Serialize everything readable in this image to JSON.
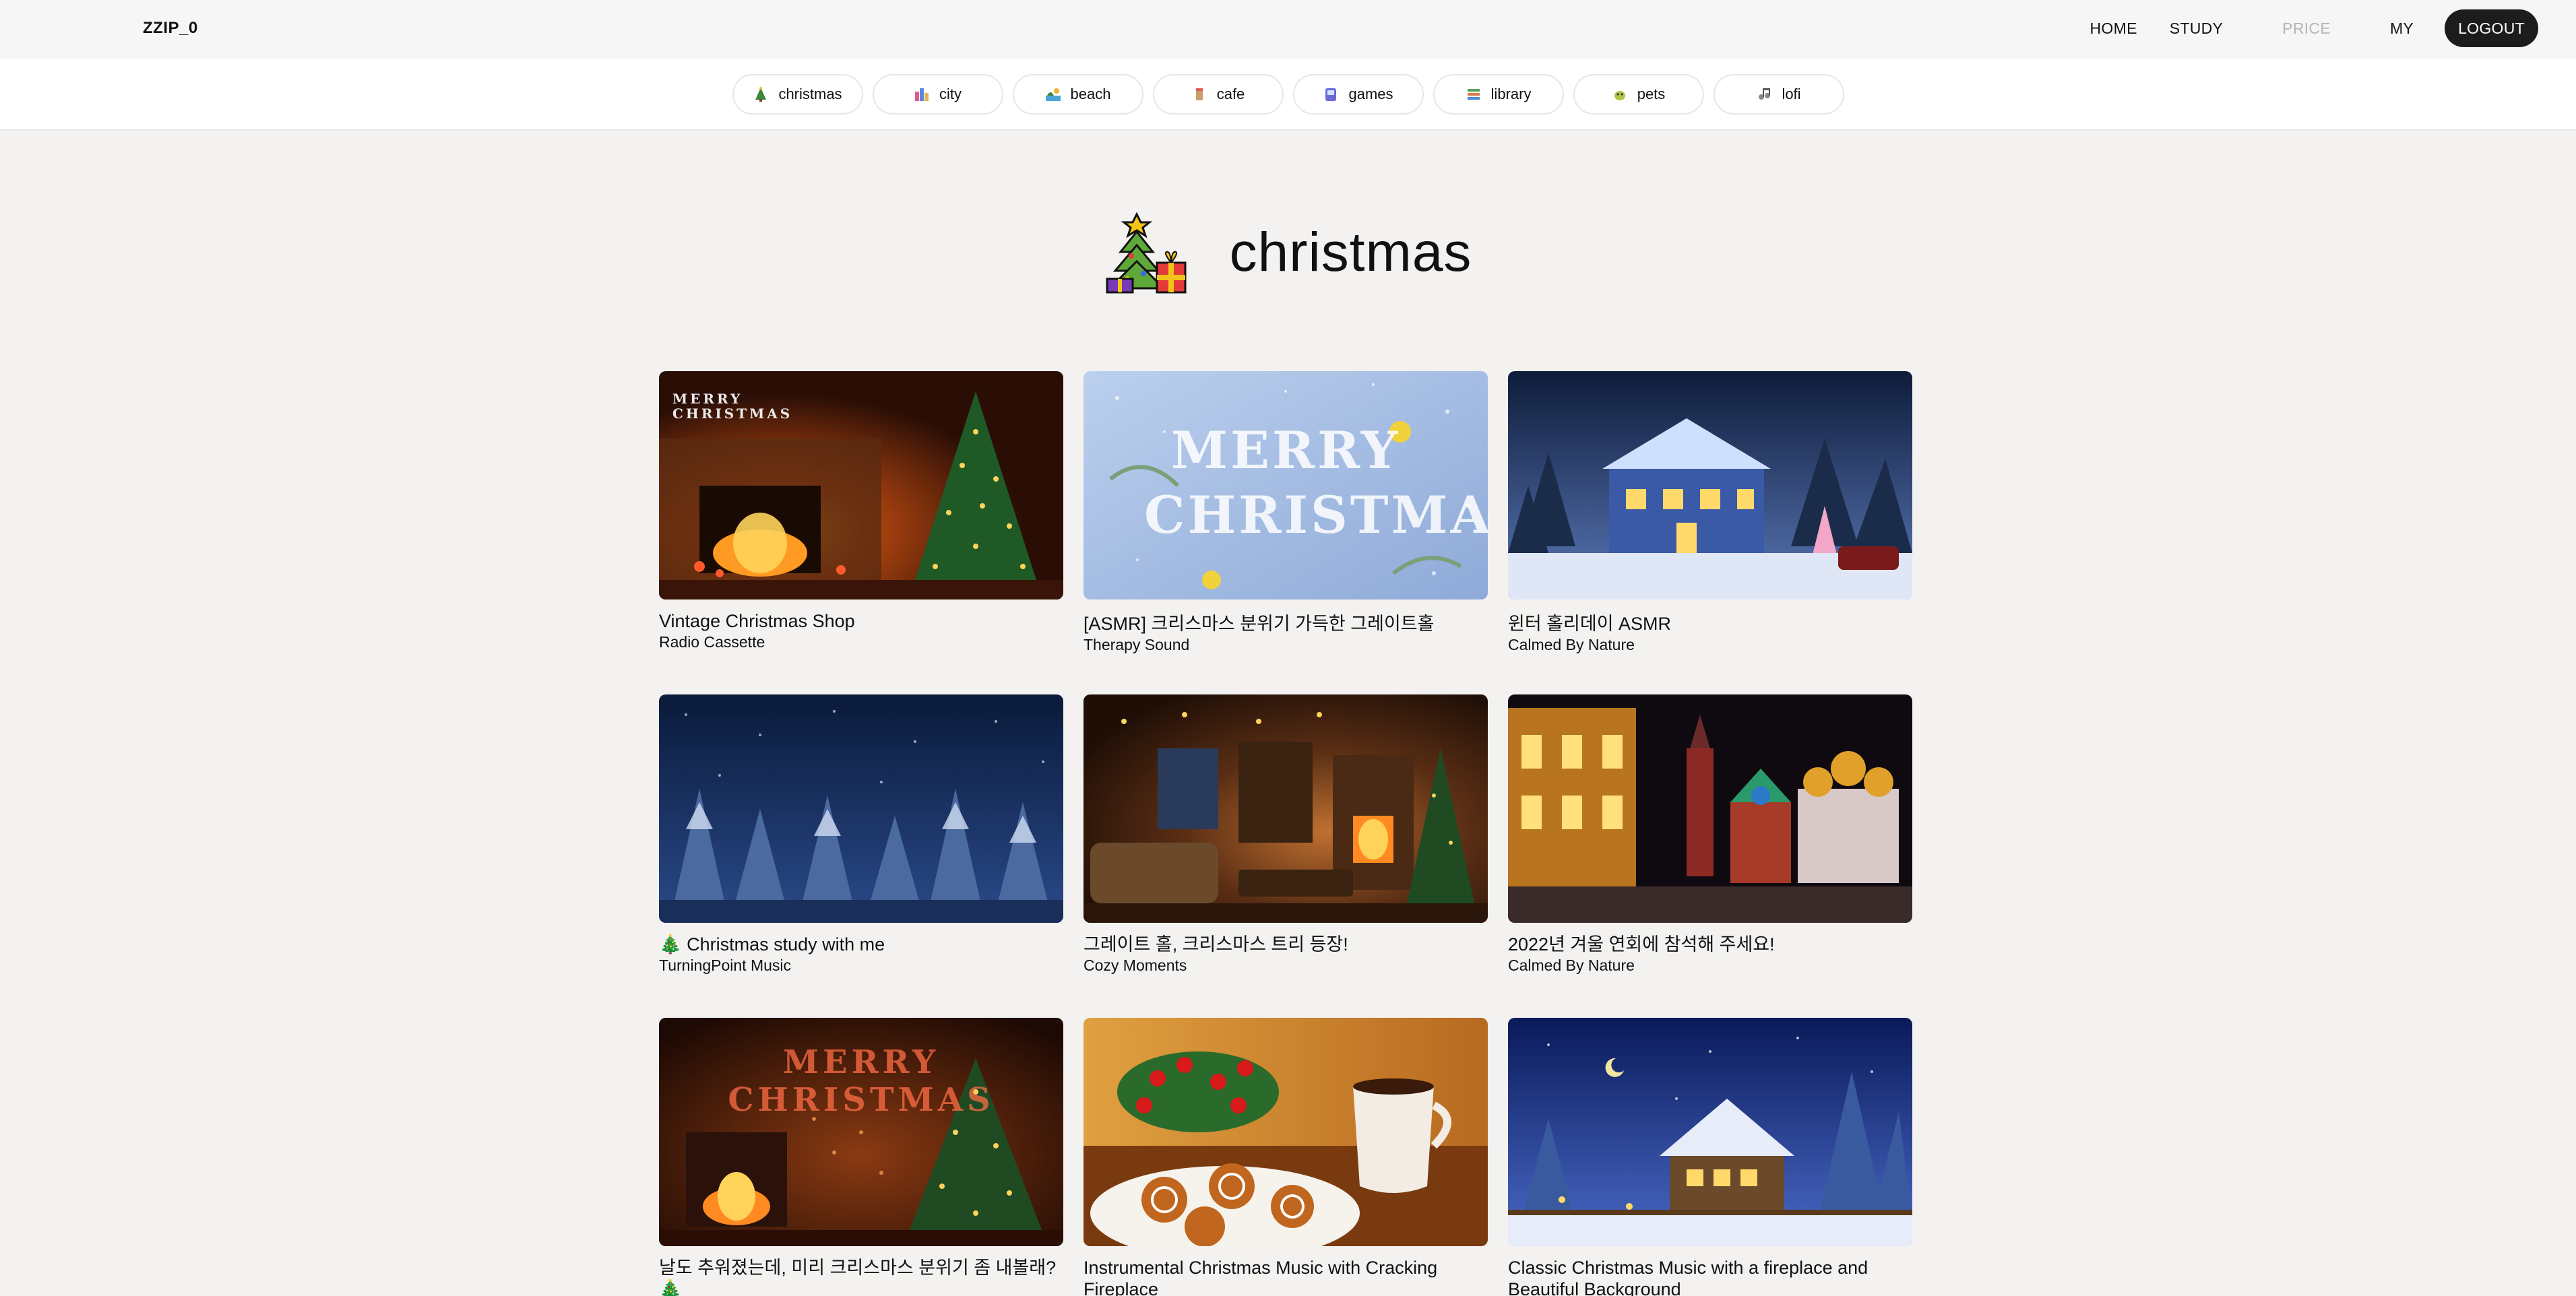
{
  "brand": "ZZIP_0",
  "nav": {
    "home": "HOME",
    "study": "STUDY",
    "price": "PRICE",
    "my": "MY",
    "logout": "LOGOUT"
  },
  "categories": [
    {
      "label": "christmas",
      "icon": "christmas-tree-icon"
    },
    {
      "label": "city",
      "icon": "city-icon"
    },
    {
      "label": "beach",
      "icon": "beach-icon"
    },
    {
      "label": "cafe",
      "icon": "cafe-icon"
    },
    {
      "label": "games",
      "icon": "games-icon"
    },
    {
      "label": "library",
      "icon": "library-icon"
    },
    {
      "label": "pets",
      "icon": "pets-icon"
    },
    {
      "label": "lofi",
      "icon": "lofi-icon"
    }
  ],
  "hero": {
    "title": "christmas",
    "icon": "christmas-tree-gift-icon"
  },
  "videos": [
    {
      "title": "Vintage Christmas Shop",
      "channel": "Radio Cassette"
    },
    {
      "title": "[ASMR] 크리스마스 분위기 가득한 그레이트홀",
      "channel": "Therapy Sound"
    },
    {
      "title": "윈터 홀리데이 ASMR",
      "channel": "Calmed By Nature"
    },
    {
      "title": "🎄 Christmas study with me",
      "channel": "TurningPoint Music"
    },
    {
      "title": "그레이트 홀, 크리스마스 트리 등장!",
      "channel": "Cozy Moments"
    },
    {
      "title": "2022년 겨울 연회에 참석해 주세요!",
      "channel": "Calmed By Nature"
    },
    {
      "title": "날도 추워졌는데, 미리 크리스마스 분위기 좀 내볼래? 🎄",
      "channel": ""
    },
    {
      "title": "Instrumental Christmas Music with Cracking Fireplace",
      "channel": ""
    },
    {
      "title": "Classic Christmas Music with a fireplace and Beautiful Background",
      "channel": ""
    }
  ],
  "thumb_text": {
    "fireplace": "MERRY CHRISTMAS",
    "merry": "MERRY CHRISTMAS",
    "neon": "MERRY CHRISTMAS"
  }
}
